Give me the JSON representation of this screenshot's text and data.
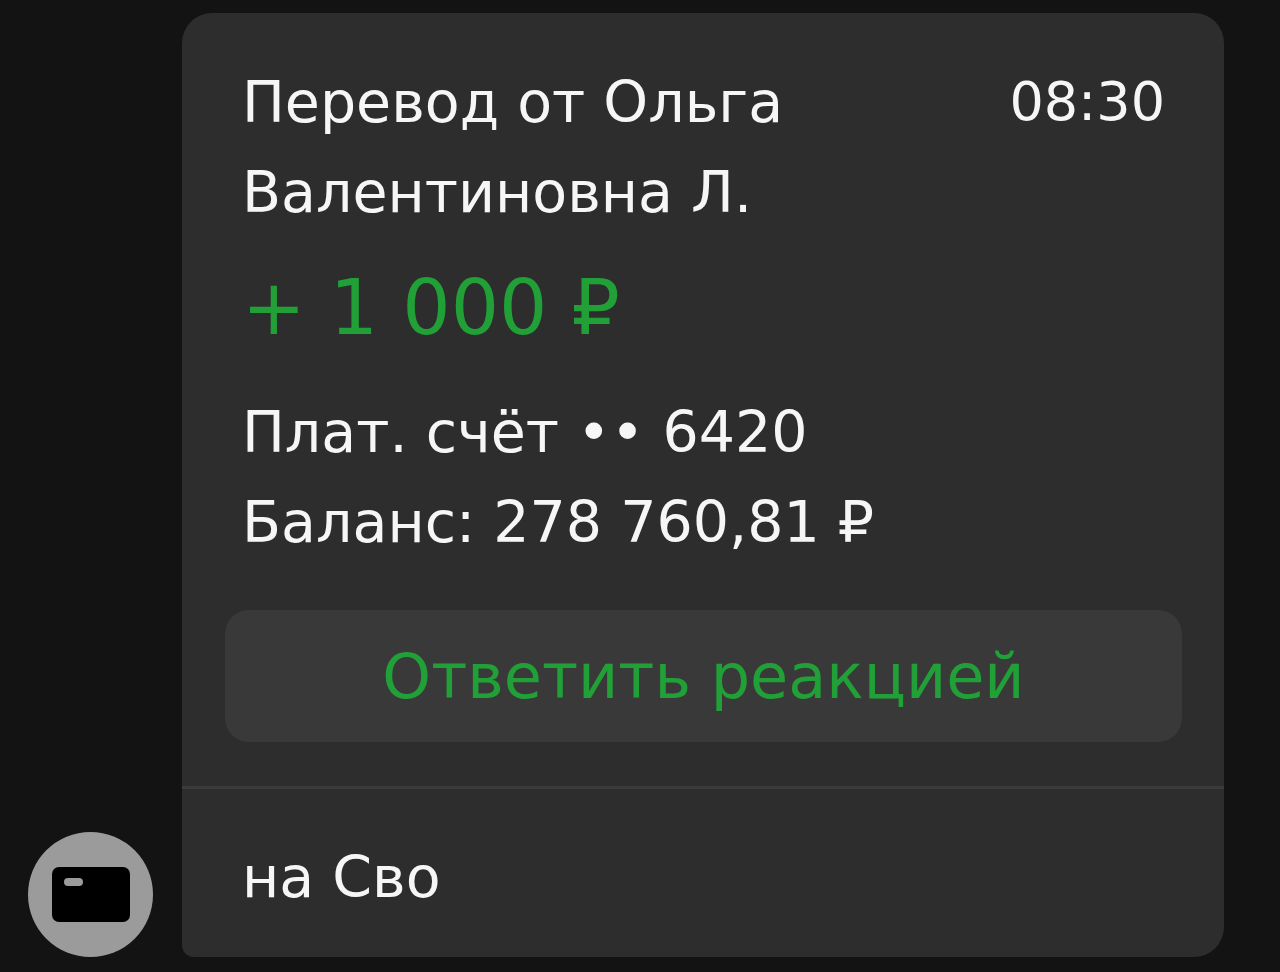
{
  "avatar": {
    "kind": "card"
  },
  "message": {
    "title": "Перевод от Ольга Валентиновна Л.",
    "time": "08:30",
    "amount": "+ 1 000 ₽",
    "account": "Плат. счёт •• 6420",
    "balance": "Баланс: 278 760,81 ₽",
    "reaction_button": "Ответить реакцией",
    "comment": "на Сво"
  }
}
